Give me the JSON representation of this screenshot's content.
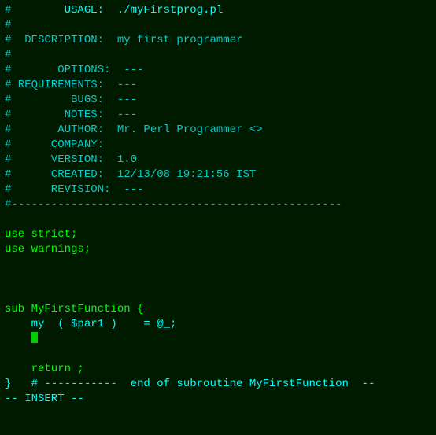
{
  "editor": {
    "lines": [
      {
        "id": "line-1",
        "parts": [
          {
            "text": "#",
            "cls": "cyan"
          },
          {
            "text": "        USAGE:  ./myFirstprog.pl",
            "cls": "bright-cyan"
          }
        ]
      },
      {
        "id": "line-2",
        "parts": [
          {
            "text": "#",
            "cls": "cyan"
          }
        ]
      },
      {
        "id": "line-3",
        "parts": [
          {
            "text": "#  DESCRIPTION:  my first programmer",
            "cls": "cyan"
          }
        ]
      },
      {
        "id": "line-4",
        "parts": [
          {
            "text": "#",
            "cls": "cyan"
          }
        ]
      },
      {
        "id": "line-5",
        "parts": [
          {
            "text": "#       OPTIONS:  ---",
            "cls": "cyan"
          }
        ]
      },
      {
        "id": "line-6",
        "parts": [
          {
            "text": "# REQUIREMENTS:  ---",
            "cls": "cyan"
          }
        ]
      },
      {
        "id": "line-7",
        "parts": [
          {
            "text": "#         BUGS:  ---",
            "cls": "cyan"
          }
        ]
      },
      {
        "id": "line-8",
        "parts": [
          {
            "text": "#        NOTES:  ---",
            "cls": "cyan"
          }
        ]
      },
      {
        "id": "line-9",
        "parts": [
          {
            "text": "#       AUTHOR:  Mr. Perl Programmer <>",
            "cls": "cyan"
          }
        ]
      },
      {
        "id": "line-10",
        "parts": [
          {
            "text": "#      COMPANY:",
            "cls": "cyan"
          }
        ]
      },
      {
        "id": "line-11",
        "parts": [
          {
            "text": "#      VERSION:  1.0",
            "cls": "cyan"
          }
        ]
      },
      {
        "id": "line-12",
        "parts": [
          {
            "text": "#      CREATED:  12/13/08 19:21:56 IST",
            "cls": "cyan"
          }
        ]
      },
      {
        "id": "line-13",
        "parts": [
          {
            "text": "#      REVISION:  ---",
            "cls": "cyan"
          }
        ]
      },
      {
        "id": "line-14",
        "parts": [
          {
            "text": "#--------------------------------------------------",
            "cls": "dashed"
          }
        ]
      },
      {
        "id": "line-15",
        "parts": [
          {
            "text": "",
            "cls": "green"
          }
        ]
      },
      {
        "id": "line-16",
        "parts": [
          {
            "text": "use strict;",
            "cls": "bright-green"
          }
        ]
      },
      {
        "id": "line-17",
        "parts": [
          {
            "text": "use warnings;",
            "cls": "bright-green"
          }
        ]
      },
      {
        "id": "line-18",
        "parts": [
          {
            "text": "",
            "cls": "green"
          }
        ]
      },
      {
        "id": "line-19",
        "parts": [
          {
            "text": "",
            "cls": "green"
          }
        ]
      },
      {
        "id": "line-20",
        "parts": [
          {
            "text": "",
            "cls": "green"
          }
        ]
      },
      {
        "id": "line-21",
        "parts": [
          {
            "text": "sub MyFirstFunction {",
            "cls": "bright-green"
          }
        ]
      },
      {
        "id": "line-22",
        "parts": [
          {
            "text": "    my  ( $par1 )    = @_;",
            "cls": "bright-cyan"
          }
        ]
      },
      {
        "id": "line-23",
        "parts": [
          {
            "text": "    ",
            "cls": "bright-green"
          },
          {
            "text": " ",
            "cls": "cursor"
          }
        ]
      },
      {
        "id": "line-24",
        "parts": [
          {
            "text": "",
            "cls": "green"
          }
        ]
      },
      {
        "id": "line-25",
        "parts": [
          {
            "text": "    return ;",
            "cls": "bright-green"
          }
        ]
      },
      {
        "id": "line-26",
        "parts": [
          {
            "text": "}   # -----------  end of subroutine MyFirstFunction  --",
            "cls": "bright-cyan"
          }
        ]
      }
    ],
    "status": "-- INSERT --"
  }
}
